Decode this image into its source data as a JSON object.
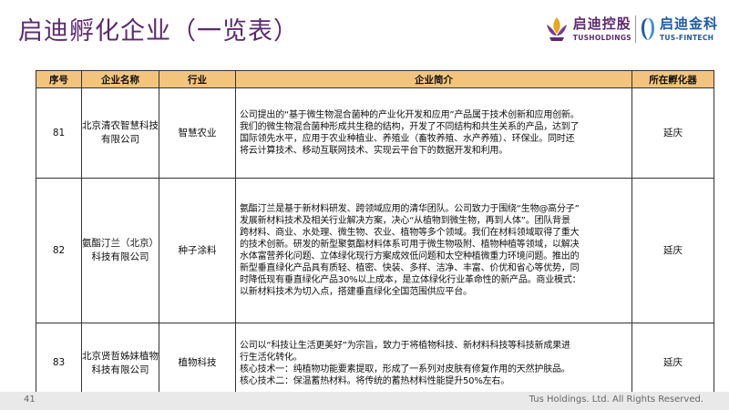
{
  "header": {
    "title": "启迪孵化企业（一览表）",
    "logo1": {
      "cn": "启迪控股",
      "en": "TUSHOLDINGS"
    },
    "logo2": {
      "cn": "启迪金科",
      "en": "TUS-FINTECH"
    }
  },
  "table": {
    "headers": [
      "序号",
      "企业名称",
      "行业",
      "企业简介",
      "所在孵化器"
    ],
    "rows": [
      {
        "no": "81",
        "name": "北京清农智慧科技有限公司",
        "industry": "智慧农业",
        "summary": [
          "公司提出的“基于微生物混合菌种的产业化开发和应用”产品属于技术创新和应用创新。",
          "我们的微生物混合菌种形成共生稳的结构，开发了不同结构和共生关系的产品，达到了",
          "国际领先水平，应用于农业种植业、养殖业（畜牧养殖、水产养殖）、环保业。同时还",
          "将云计算技术、移动互联网技术、实现云平台下的数据开发和利用。"
        ],
        "incubator": "延庆"
      },
      {
        "no": "82",
        "name": "氨酯汀兰（北京）科技有限公司",
        "industry": "种子涂料",
        "summary": [
          "氨酯汀兰是基于新材料研发、跨领域应用的清华团队。公司致力于围绕“生物@高分子”",
          "发展新材料技术及相关行业解决方案，决心“从植物到微生物，再到人体”。团队背景",
          "跨材料、商业、水处理、微生物、农业、植物等多个领域。我们在材料领域取得了重大",
          "的技术创新。研发的新型聚氨酯材料体系可用于微生物吸附、植物种植等领域，以解决",
          "水体富营养化问题、立体绿化现行方案成效低问题和太空种植微重力环境问题。推出的",
          "新型垂直绿化产品具有质轻、植密、快装、多样、洁净、丰富、价优和省心等优势，同",
          "时降低现有垂直绿化产品30%以上成本，是立体绿化行业革命性的新产品。商业模式：",
          "以新材料技术为切入点，搭建垂直绿化全国范围供应平台。"
        ],
        "incubator": "延庆"
      },
      {
        "no": "83",
        "name": "北京贤哲姊妹植物科技有限公司",
        "industry": "植物科技",
        "summary": [
          "公司以“科技让生活更美好”为宗旨，致力于将植物科技、新材料科技等科技新成果进",
          "行生活化转化。",
          "核心技术一：纯植物功能要素提取，形成了一系列对皮肤有修复作用的天然护肤品。",
          "核心技术二：保温蓄热材料。将传统的蓄热材料性能提升50%左右。"
        ],
        "incubator": "延庆"
      }
    ]
  },
  "footer": {
    "page": "41",
    "copyright": "Tus Holdings. Ltd. All Rights Reserved."
  }
}
